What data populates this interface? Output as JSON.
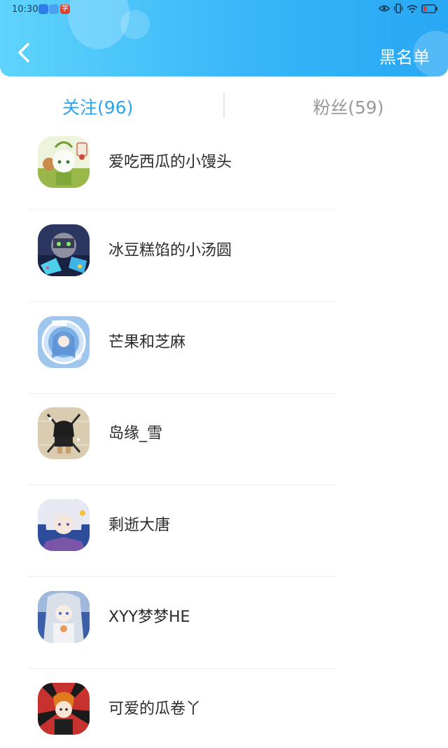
{
  "status_bar": {
    "time": "10:30",
    "notification_badge": "学"
  },
  "header": {
    "right_action": "黑名单"
  },
  "tabs": [
    {
      "label": "关注(96)",
      "active": true
    },
    {
      "label": "粉丝(59)",
      "active": false
    }
  ],
  "users": [
    {
      "name": "爱吃西瓜的小馒头"
    },
    {
      "name": "冰豆糕馅的小汤圆"
    },
    {
      "name": "芒果和芝麻"
    },
    {
      "name": "岛缘_雪"
    },
    {
      "name": "剩逝大唐"
    },
    {
      "name": "XYY梦梦HE"
    },
    {
      "name": "可爱的瓜卷丫"
    }
  ],
  "colors": {
    "accent": "#2aa4ee",
    "header_gradient_start": "#5fd3fb",
    "header_gradient_end": "#28a7f4",
    "tab_inactive": "#9a9a9a"
  }
}
